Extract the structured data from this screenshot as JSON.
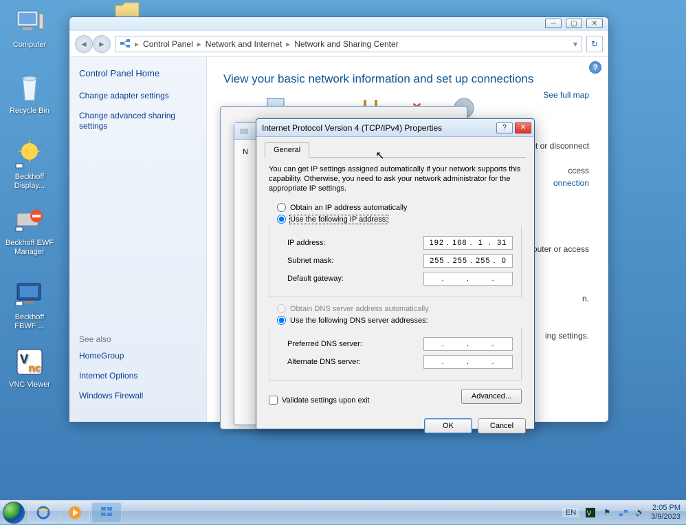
{
  "desktop": {
    "icons": [
      {
        "label": "Computer"
      },
      {
        "label": "Recycle Bin"
      },
      {
        "label": "Beckhoff Display..."
      },
      {
        "label": "Beckhoff EWF Manager"
      },
      {
        "label": "Beckhoff FBWF ..."
      },
      {
        "label": "VNC Viewer"
      }
    ]
  },
  "window": {
    "breadcrumbs": [
      "Control Panel",
      "Network and Internet",
      "Network and Sharing Center"
    ],
    "sidebar": {
      "home": "Control Panel Home",
      "links": [
        "Change adapter settings",
        "Change advanced sharing settings"
      ],
      "see_also_label": "See also",
      "see_also": [
        "HomeGroup",
        "Internet Options",
        "Windows Firewall"
      ]
    },
    "main": {
      "title": "View your basic network information and set up connections",
      "see_full_map": "See full map",
      "right_texts": [
        "ect or disconnect",
        "ccess",
        "onnection",
        "router or access",
        "n.",
        "ing settings."
      ]
    }
  },
  "dialog": {
    "title": "Internet Protocol Version 4 (TCP/IPv4) Properties",
    "tab": "General",
    "description": "You can get IP settings assigned automatically if your network supports this capability. Otherwise, you need to ask your network administrator for the appropriate IP settings.",
    "radio_auto_ip": "Obtain an IP address automatically",
    "radio_use_ip": "Use the following IP address:",
    "ip_label": "IP address:",
    "ip_value": "192 . 168 .  1  .  31",
    "subnet_label": "Subnet mask:",
    "subnet_value": "255 . 255 . 255 .  0",
    "gateway_label": "Default gateway:",
    "gateway_value": ".        .        .",
    "radio_auto_dns": "Obtain DNS server address automatically",
    "radio_use_dns": "Use the following DNS server addresses:",
    "pref_dns_label": "Preferred DNS server:",
    "pref_dns_value": ".        .        .",
    "alt_dns_label": "Alternate DNS server:",
    "alt_dns_value": ".        .        .",
    "validate": "Validate settings upon exit",
    "advanced": "Advanced...",
    "ok": "OK",
    "cancel": "Cancel"
  },
  "taskbar": {
    "lang": "EN",
    "time": "2:05 PM",
    "date": "3/9/2023"
  }
}
